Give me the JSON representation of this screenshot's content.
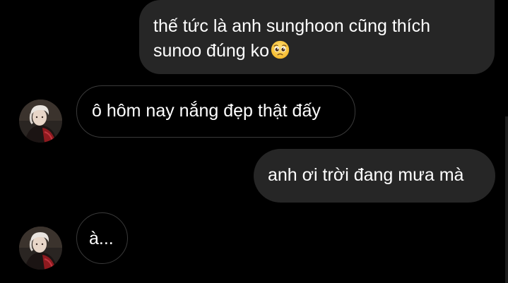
{
  "messages": [
    {
      "direction": "sent",
      "text_line1": "thế tức là anh sunghoon cũng thích",
      "text_line2": "sunoo đúng ko",
      "emoji": "pleading-face"
    },
    {
      "direction": "received",
      "text": "ô hôm nay nắng đẹp thật đấy"
    },
    {
      "direction": "sent",
      "text": "anh ơi trời đang mưa mà"
    },
    {
      "direction": "received",
      "text": "à..."
    }
  ],
  "colors": {
    "background": "#000000",
    "sent_bubble": "#262626",
    "received_border": "#3a3a3a",
    "text": "#ffffff"
  }
}
